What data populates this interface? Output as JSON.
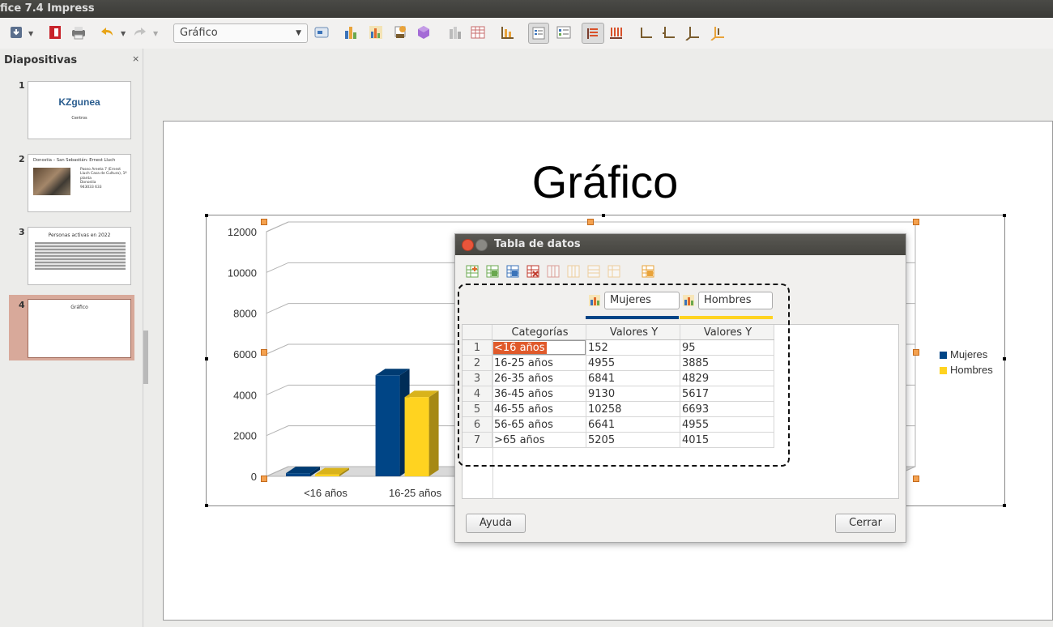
{
  "window": {
    "title": "fice 7.4 Impress"
  },
  "toolbar": {
    "chart_type_select": "Gráfico",
    "icons": [
      "save-dropdown-icon",
      "export-pdf-icon",
      "print-icon",
      "undo-icon",
      "redo-icon",
      "chart-element-icon",
      "chart-type-icon",
      "chart-data-icon",
      "chart-wall-icon",
      "chart-3d-icon",
      "chart-area-icon",
      "data-table-icon",
      "horizontal-grids-icon",
      "legend-on-off-icon",
      "legend-icon",
      "data-series-rows-icon",
      "data-series-columns-icon",
      "x-axis-icon",
      "y-axis-icon",
      "all-axes-icon",
      "axes-title-icon"
    ]
  },
  "slides_pane": {
    "title": "Diapositivas",
    "close": "×",
    "slides": [
      {
        "number": "1",
        "title": "KZgunea",
        "subtitle": "Centros"
      },
      {
        "number": "2",
        "title": "Donostia – San Sebastián: Ernest Lluch",
        "bullets": [
          "Paseo Areeta 7 (Ernest Lluch Casa de Cultura), 1º planta",
          "Donostia",
          "943033 633"
        ]
      },
      {
        "number": "3",
        "title": "Personas activas en 2022"
      },
      {
        "number": "4",
        "title": "Gráfico"
      }
    ]
  },
  "slide": {
    "title": "Gráfico"
  },
  "chart_data": {
    "type": "bar",
    "subtype": "3d-clustered",
    "categories": [
      "<16 años",
      "16-25 años",
      "26-35 años",
      "36-45 años",
      "46-55 años",
      "56-65 años",
      ">65 años"
    ],
    "series": [
      {
        "name": "Mujeres",
        "values": [
          152,
          4955,
          6841,
          9130,
          10258,
          6641,
          5205
        ],
        "color": "#004586"
      },
      {
        "name": "Hombres",
        "values": [
          95,
          3885,
          4829,
          5617,
          6693,
          4955,
          4015
        ],
        "color": "#ffd320"
      }
    ],
    "ylim": [
      0,
      12000
    ],
    "yticks": [
      "12000",
      "10000",
      "8000",
      "6000",
      "4000",
      "2000",
      "0"
    ],
    "visible_xtick_labels": [
      "<16 años",
      "16-25 años"
    ],
    "grid": true,
    "legend": "right"
  },
  "dialog": {
    "title": "Tabla de datos",
    "series_headers": [
      "Mujeres",
      "Hombres"
    ],
    "columns": [
      "Categorías",
      "Valores Y",
      "Valores Y"
    ],
    "rows": [
      [
        "1",
        "<16 años",
        "152",
        "95"
      ],
      [
        "2",
        "16-25 años",
        "4955",
        "3885"
      ],
      [
        "3",
        "26-35 años",
        "6841",
        "4829"
      ],
      [
        "4",
        "36-45 años",
        "9130",
        "5617"
      ],
      [
        "5",
        "46-55 años",
        "10258",
        "6693"
      ],
      [
        "6",
        "56-65 años",
        "6641",
        "4955"
      ],
      [
        "7",
        ">65 años",
        "5205",
        "4015"
      ]
    ],
    "help_button": "Ayuda",
    "close_button": "Cerrar",
    "toolbar_icons": [
      "insert-row-icon",
      "insert-series-icon",
      "insert-text-column-icon",
      "delete-row-icon",
      "delete-series-icon",
      "move-series-right-icon",
      "move-series-left-icon",
      "move-row-up-icon",
      "move-row-down-icon"
    ]
  }
}
